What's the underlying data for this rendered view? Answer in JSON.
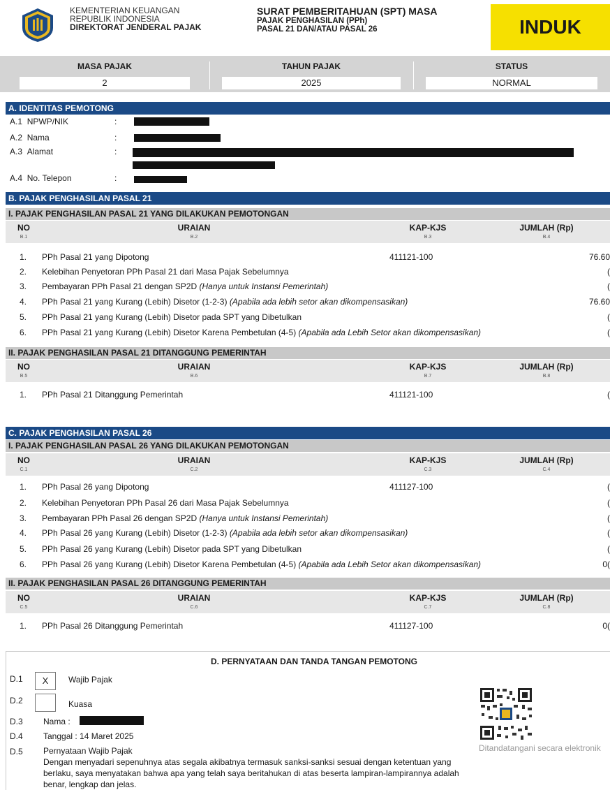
{
  "header": {
    "ministry_line1": "KEMENTERIAN KEUANGAN",
    "ministry_line2": "REPUBLIK INDONESIA",
    "ministry_line3": "DIREKTORAT JENDERAL PAJAK",
    "title_line1": "SURAT PEMBERITAHUAN (SPT) MASA",
    "title_line2": "PAJAK PENGHASILAN (PPh)",
    "title_line3": "PASAL 21 DAN/ATAU PASAL 26",
    "badge": "INDUK"
  },
  "period": {
    "masa_label": "MASA PAJAK",
    "masa_value": "2",
    "tahun_label": "TAHUN PAJAK",
    "tahun_value": "2025",
    "status_label": "STATUS",
    "status_value": "NORMAL"
  },
  "section_a": {
    "title": "A. IDENTITAS PEMOTONG",
    "fields": [
      {
        "code": "A.1",
        "label": "NPWP/NIK",
        "colon": ":"
      },
      {
        "code": "A.2",
        "label": "Nama",
        "colon": ":"
      },
      {
        "code": "A.3",
        "label": "Alamat",
        "colon": ":"
      },
      {
        "code": "A.4",
        "label": "No. Telepon",
        "colon": ":"
      }
    ]
  },
  "section_b": {
    "title": "B. PAJAK PENGHASILAN PASAL 21",
    "part1": {
      "title": "I. PAJAK PENGHASILAN PASAL 21 YANG DILAKUKAN PEMOTONGAN",
      "headers": {
        "no": "NO",
        "uraian": "URAIAN",
        "kap": "KAP-KJS",
        "jumlah": "JUMLAH (Rp)"
      },
      "codes": {
        "no": "B.1",
        "uraian": "B.2",
        "kap": "B.3",
        "jumlah": "B.4"
      },
      "rows": [
        {
          "no": "1.",
          "text": "PPh Pasal 21 yang Dipotong",
          "note": "",
          "kap": "411121-100",
          "jumlah": "76.60"
        },
        {
          "no": "2.",
          "text": "Kelebihan Penyetoran PPh Pasal 21 dari Masa Pajak Sebelumnya",
          "note": "",
          "kap": "",
          "jumlah": "("
        },
        {
          "no": "3.",
          "text": "Pembayaran PPh Pasal 21 dengan SP2D ",
          "note": "(Hanya untuk Instansi Pemerintah)",
          "kap": "",
          "jumlah": "("
        },
        {
          "no": "4.",
          "text": "PPh Pasal 21 yang Kurang (Lebih) Disetor (1-2-3) ",
          "note": "(Apabila ada lebih setor akan dikompensasikan)",
          "kap": "",
          "jumlah": "76.60"
        },
        {
          "no": "5.",
          "text": "PPh Pasal 21 yang Kurang (Lebih) Disetor pada SPT yang Dibetulkan",
          "note": "",
          "kap": "",
          "jumlah": "("
        },
        {
          "no": "6.",
          "text": "PPh Pasal 21 yang Kurang (Lebih) Disetor Karena Pembetulan (4-5) ",
          "note": "(Apabila ada Lebih Setor akan dikompensasikan)",
          "kap": "",
          "jumlah": "("
        }
      ]
    },
    "part2": {
      "title": "II. PAJAK PENGHASILAN PASAL 21 DITANGGUNG PEMERINTAH",
      "headers": {
        "no": "NO",
        "uraian": "URAIAN",
        "kap": "KAP-KJS",
        "jumlah": "JUMLAH (Rp)"
      },
      "codes": {
        "no": "B.5",
        "uraian": "B.6",
        "kap": "B.7",
        "jumlah": "B.8"
      },
      "rows": [
        {
          "no": "1.",
          "text": "PPh Pasal 21 Ditanggung Pemerintah",
          "note": "",
          "kap": "411121-100",
          "jumlah": "("
        }
      ]
    }
  },
  "section_c": {
    "title": "C. PAJAK PENGHASILAN PASAL 26",
    "part1": {
      "title": "I. PAJAK PENGHASILAN PASAL 26 YANG DILAKUKAN PEMOTONGAN",
      "headers": {
        "no": "NO",
        "uraian": "URAIAN",
        "kap": "KAP-KJS",
        "jumlah": "JUMLAH (Rp)"
      },
      "codes": {
        "no": "C.1",
        "uraian": "C.2",
        "kap": "C.3",
        "jumlah": "C.4"
      },
      "rows": [
        {
          "no": "1.",
          "text": "PPh Pasal 26 yang Dipotong",
          "note": "",
          "kap": "411127-100",
          "jumlah": "("
        },
        {
          "no": "2.",
          "text": "Kelebihan Penyetoran PPh Pasal 26 dari Masa Pajak Sebelumnya",
          "note": "",
          "kap": "",
          "jumlah": "("
        },
        {
          "no": "3.",
          "text": "Pembayaran PPh Pasal 26 dengan SP2D ",
          "note": "(Hanya untuk Instansi Pemerintah)",
          "kap": "",
          "jumlah": "("
        },
        {
          "no": "4.",
          "text": "PPh Pasal 26 yang Kurang (Lebih) Disetor (1-2-3) ",
          "note": "(Apabila ada lebih setor akan dikompensasikan)",
          "kap": "",
          "jumlah": "("
        },
        {
          "no": "5.",
          "text": "PPh Pasal 26 yang Kurang (Lebih) Disetor pada SPT yang Dibetulkan",
          "note": "",
          "kap": "",
          "jumlah": "("
        },
        {
          "no": "6.",
          "text": "PPh Pasal 26 yang Kurang (Lebih) Disetor Karena Pembetulan (4-5) ",
          "note": "(Apabila ada Lebih Setor akan dikompensasikan)",
          "kap": "",
          "jumlah": "0("
        }
      ]
    },
    "part2": {
      "title": "II. PAJAK PENGHASILAN PASAL 26 DITANGGUNG PEMERINTAH",
      "headers": {
        "no": "NO",
        "uraian": "URAIAN",
        "kap": "KAP-KJS",
        "jumlah": "JUMLAH (Rp)"
      },
      "codes": {
        "no": "C.5",
        "uraian": "C.6",
        "kap": "C.7",
        "jumlah": "C.8"
      },
      "rows": [
        {
          "no": "1.",
          "text": "PPh Pasal 26 Ditanggung Pemerintah",
          "note": "",
          "kap": "411127-100",
          "jumlah": "0("
        }
      ]
    }
  },
  "section_d": {
    "title": "D. PERNYATAAN DAN TANDA TANGAN PEMOTONG",
    "d1_code": "D.1",
    "d1_mark": "X",
    "d1_label": "Wajib Pajak",
    "d2_code": "D.2",
    "d2_mark": "",
    "d2_label": "Kuasa",
    "d3_code": "D.3",
    "d3_label": "Nama :",
    "d4_code": "D.4",
    "d4_label": "Tanggal : 14 Maret 2025",
    "d5_code": "D.5",
    "d5_label": "Pernyataan Wajib Pajak",
    "statement": "Dengan menyadari sepenuhnya atas segala akibatnya termasuk sanksi-sanksi sesuai dengan ketentuan yang berlaku, saya menyatakan bahwa apa yang telah saya beritahukan di atas beserta lampiran-lampirannya adalah benar, lengkap dan jelas.",
    "esign": "Ditandatangani secara elektronik"
  }
}
